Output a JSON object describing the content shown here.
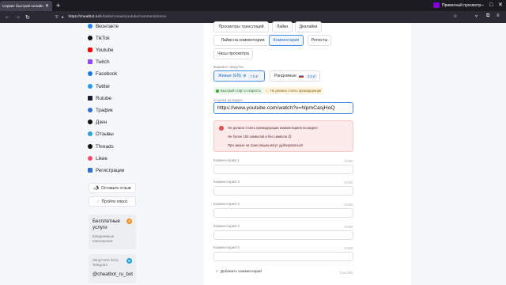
{
  "browser": {
    "tab_title": "Сервис быстрой онлайн-нак",
    "new_tab": "+",
    "private_label": "Приватный просмотр",
    "url_host": "https://cheatbot.ru",
    "url_path": "/lk/tasks/create/youtube/comments/once",
    "win_min": "–",
    "win_max": "□",
    "win_close": "✕"
  },
  "sidebar": {
    "items": [
      {
        "label": "Вконтакте",
        "color": "#2787f5"
      },
      {
        "label": "TikTok",
        "color": "#111111"
      },
      {
        "label": "Youtube",
        "color": "#ff0000"
      },
      {
        "label": "Twitch",
        "color": "#9146ff"
      },
      {
        "label": "Facebook",
        "color": "#1877f2"
      },
      {
        "label": "Twitter",
        "color": "#1d9bf0"
      },
      {
        "label": "Rutube",
        "color": "#1a1a2e"
      },
      {
        "label": "Трафик",
        "color": "#2f6fd6"
      },
      {
        "label": "Дзен",
        "color": "#111111"
      },
      {
        "label": "Отзывы",
        "color": "#2aa3d8"
      },
      {
        "label": "Threads",
        "color": "#111111"
      },
      {
        "label": "Likee",
        "color": "#ff4b6e"
      },
      {
        "label": "Регистрации",
        "color": "#2f6fd6"
      }
    ],
    "leave_review": "Оставьте отзыв",
    "take_survey": "Пройти опрос",
    "free_services_title": "Бесплатные услуги",
    "free_services_sub": "Ежедневные пополнения",
    "free_badge": "₽",
    "bot_sub": "Запустите бота Telegram",
    "bot_handle": "@cheatbot_ru_bot"
  },
  "main": {
    "service_tabs": [
      "Просмотры трансляций",
      "Лайки",
      "Дизлайки",
      "Лайки на комментарии",
      "Комментарии",
      "Репосты",
      "Часы просмотра"
    ],
    "active_tab": "Комментарии",
    "variant_label": "Вариант накрутки",
    "variant_live": "Живые (EN)",
    "variant_live_price": "7.5 ₽",
    "variant_random": "Рандомные",
    "variant_random_price": "3.5 ₽",
    "chip_fast": "Быстрый старт и скорость",
    "chip_warn": "Не должно стоять премодерации",
    "link_label": "Ссылка на видео",
    "link_value": "https://www.youtube.com/watch?v=hlpmCasjHoQ",
    "alert_lines": [
      "Не должно стоять премодерации комментариев на видео!",
      "Не более 150 символов и без символа @",
      "При заказе на трансляцию могут дублироваться!"
    ],
    "comments": [
      {
        "label": "Комментарий 1",
        "counter": "0/150"
      },
      {
        "label": "Комментарий 2",
        "counter": "0/150"
      },
      {
        "label": "Комментарий 3",
        "counter": "0/150"
      },
      {
        "label": "Комментарий 4",
        "counter": "0/150"
      },
      {
        "label": "Комментарий 5",
        "counter": "0/150"
      }
    ],
    "add_comment": "Добавить комментарий",
    "add_count": "5 из 250"
  }
}
